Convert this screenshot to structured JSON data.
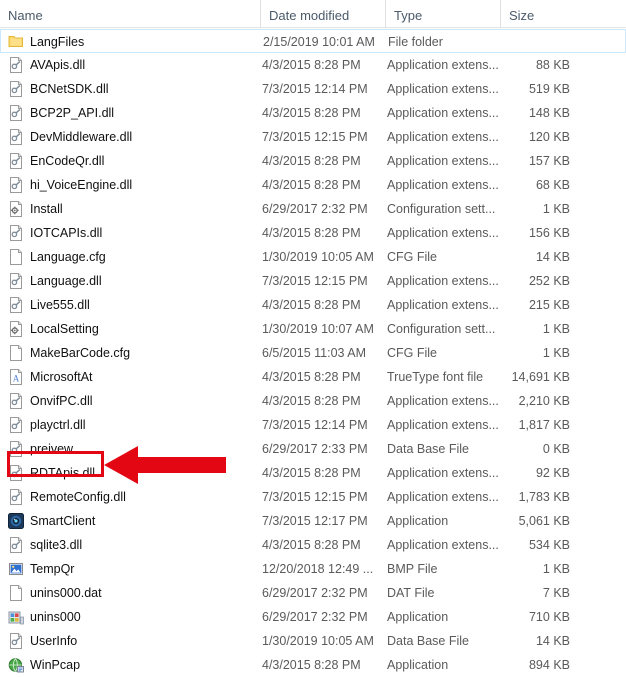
{
  "header": {
    "sort_indicator": "ascending-caret",
    "columns": [
      {
        "label": "Name",
        "key": "name"
      },
      {
        "label": "Date modified",
        "key": "date"
      },
      {
        "label": "Type",
        "key": "type"
      },
      {
        "label": "Size",
        "key": "size"
      }
    ]
  },
  "annotation": {
    "color": "#e30613",
    "target_row": "SmartClient",
    "shapes": [
      "highlight-rectangle",
      "left-pointing-arrow"
    ]
  },
  "rows": [
    {
      "name": "LangFiles",
      "date": "2/15/2019 10:01 AM",
      "type": "File folder",
      "size": "",
      "icon": "folder-icon",
      "selected": true
    },
    {
      "name": "AVApis.dll",
      "date": "4/3/2015 8:28 PM",
      "type": "Application extens...",
      "size": "88 KB",
      "icon": "dll-icon",
      "selected": false
    },
    {
      "name": "BCNetSDK.dll",
      "date": "7/3/2015 12:14 PM",
      "type": "Application extens...",
      "size": "519 KB",
      "icon": "dll-icon",
      "selected": false
    },
    {
      "name": "BCP2P_API.dll",
      "date": "4/3/2015 8:28 PM",
      "type": "Application extens...",
      "size": "148 KB",
      "icon": "dll-icon",
      "selected": false
    },
    {
      "name": "DevMiddleware.dll",
      "date": "7/3/2015 12:15 PM",
      "type": "Application extens...",
      "size": "120 KB",
      "icon": "dll-icon",
      "selected": false
    },
    {
      "name": "EnCodeQr.dll",
      "date": "4/3/2015 8:28 PM",
      "type": "Application extens...",
      "size": "157 KB",
      "icon": "dll-icon",
      "selected": false
    },
    {
      "name": "hi_VoiceEngine.dll",
      "date": "4/3/2015 8:28 PM",
      "type": "Application extens...",
      "size": "68 KB",
      "icon": "dll-icon",
      "selected": false
    },
    {
      "name": "Install",
      "date": "6/29/2017 2:32 PM",
      "type": "Configuration sett...",
      "size": "1 KB",
      "icon": "config-settings-icon",
      "selected": false
    },
    {
      "name": "IOTCAPIs.dll",
      "date": "4/3/2015 8:28 PM",
      "type": "Application extens...",
      "size": "156 KB",
      "icon": "dll-icon",
      "selected": false
    },
    {
      "name": "Language.cfg",
      "date": "1/30/2019 10:05 AM",
      "type": "CFG File",
      "size": "14 KB",
      "icon": "blank-file-icon",
      "selected": false
    },
    {
      "name": "Language.dll",
      "date": "7/3/2015 12:15 PM",
      "type": "Application extens...",
      "size": "252 KB",
      "icon": "dll-icon",
      "selected": false
    },
    {
      "name": "Live555.dll",
      "date": "4/3/2015 8:28 PM",
      "type": "Application extens...",
      "size": "215 KB",
      "icon": "dll-icon",
      "selected": false
    },
    {
      "name": "LocalSetting",
      "date": "1/30/2019 10:07 AM",
      "type": "Configuration sett...",
      "size": "1 KB",
      "icon": "config-settings-icon",
      "selected": false
    },
    {
      "name": "MakeBarCode.cfg",
      "date": "6/5/2015 11:03 AM",
      "type": "CFG File",
      "size": "1 KB",
      "icon": "blank-file-icon",
      "selected": false
    },
    {
      "name": "MicrosoftAt",
      "date": "4/3/2015 8:28 PM",
      "type": "TrueType font file",
      "size": "14,691 KB",
      "icon": "truetype-font-icon",
      "selected": false
    },
    {
      "name": "OnvifPC.dll",
      "date": "4/3/2015 8:28 PM",
      "type": "Application extens...",
      "size": "2,210 KB",
      "icon": "dll-icon",
      "selected": false
    },
    {
      "name": "playctrl.dll",
      "date": "7/3/2015 12:14 PM",
      "type": "Application extens...",
      "size": "1,817 KB",
      "icon": "dll-icon",
      "selected": false
    },
    {
      "name": "preivew",
      "date": "6/29/2017 2:33 PM",
      "type": "Data Base File",
      "size": "0 KB",
      "icon": "dll-icon",
      "selected": false
    },
    {
      "name": "RDTApis.dll",
      "date": "4/3/2015 8:28 PM",
      "type": "Application extens...",
      "size": "92 KB",
      "icon": "dll-icon",
      "selected": false
    },
    {
      "name": "RemoteConfig.dll",
      "date": "7/3/2015 12:15 PM",
      "type": "Application extens...",
      "size": "1,783 KB",
      "icon": "dll-icon",
      "selected": false
    },
    {
      "name": "SmartClient",
      "date": "7/3/2015 12:17 PM",
      "type": "Application",
      "size": "5,061 KB",
      "icon": "smartclient-app-icon",
      "selected": false
    },
    {
      "name": "sqlite3.dll",
      "date": "4/3/2015 8:28 PM",
      "type": "Application extens...",
      "size": "534 KB",
      "icon": "dll-icon",
      "selected": false
    },
    {
      "name": "TempQr",
      "date": "12/20/2018 12:49 ...",
      "type": "BMP File",
      "size": "1 KB",
      "icon": "bmp-image-icon",
      "selected": false
    },
    {
      "name": "unins000.dat",
      "date": "6/29/2017 2:32 PM",
      "type": "DAT File",
      "size": "7 KB",
      "icon": "blank-file-icon",
      "selected": false
    },
    {
      "name": "unins000",
      "date": "6/29/2017 2:32 PM",
      "type": "Application",
      "size": "710 KB",
      "icon": "installer-icon",
      "selected": false
    },
    {
      "name": "UserInfo",
      "date": "1/30/2019 10:05 AM",
      "type": "Data Base File",
      "size": "14 KB",
      "icon": "dll-icon",
      "selected": false
    },
    {
      "name": "WinPcap",
      "date": "4/3/2015 8:28 PM",
      "type": "Application",
      "size": "894 KB",
      "icon": "winpcap-app-icon",
      "selected": false
    }
  ]
}
